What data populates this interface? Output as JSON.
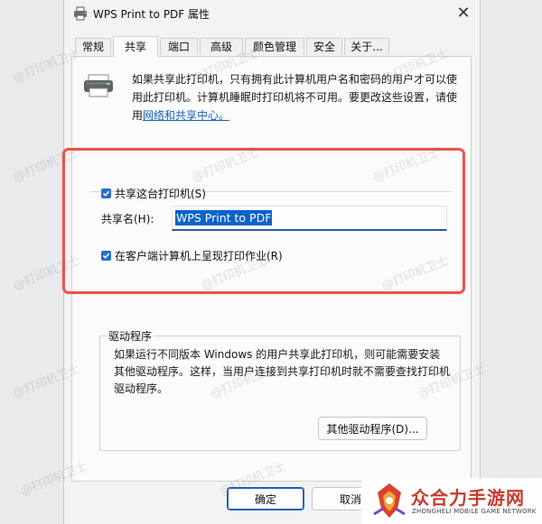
{
  "window": {
    "title": "WPS Print to PDF 属性",
    "close_glyph": "✕"
  },
  "tabs": [
    {
      "label": "常规"
    },
    {
      "label": "共享",
      "active": true
    },
    {
      "label": "端口"
    },
    {
      "label": "高级"
    },
    {
      "label": "颜色管理"
    },
    {
      "label": "安全"
    },
    {
      "label": "关于..."
    }
  ],
  "sharing": {
    "info_text": "如果共享此打印机，只有拥有此计算机用户名和密码的用户才可以使用此打印机。计算机睡眠时打印机将不可用。要更改这些设置，请使用",
    "info_link": "网络和共享中心。",
    "share_printer_label": "共享这台打印机(S)",
    "share_printer_checked": true,
    "share_name_label": "共享名(H):",
    "share_name_value": "WPS Print to PDF",
    "render_jobs_label": "在客户端计算机上呈现打印作业(R)",
    "render_jobs_checked": true
  },
  "drivers": {
    "title": "驱动程序",
    "description": "如果运行不同版本 Windows 的用户共享此打印机，则可能需要安装其他驱动程序。这样，当用户连接到共享打印机时就不需要查找打印机驱动程序。",
    "other_drivers_button": "其他驱动程序(D)..."
  },
  "footer": {
    "ok_button": "确定",
    "cancel_button": "取消"
  },
  "watermark": "@打印机卫士",
  "logo": {
    "title": "众合力手游网",
    "subtitle": "ZHONGHELI MOBILE GAME NETWORK"
  },
  "colors": {
    "accent": "#0a63c9",
    "highlight_border": "#e8544f",
    "logo_red": "#c83a2c"
  },
  "icons": {
    "title": "printer-icon",
    "panel": "printer-icon",
    "close": "close-icon",
    "check": "checkmark-icon"
  }
}
